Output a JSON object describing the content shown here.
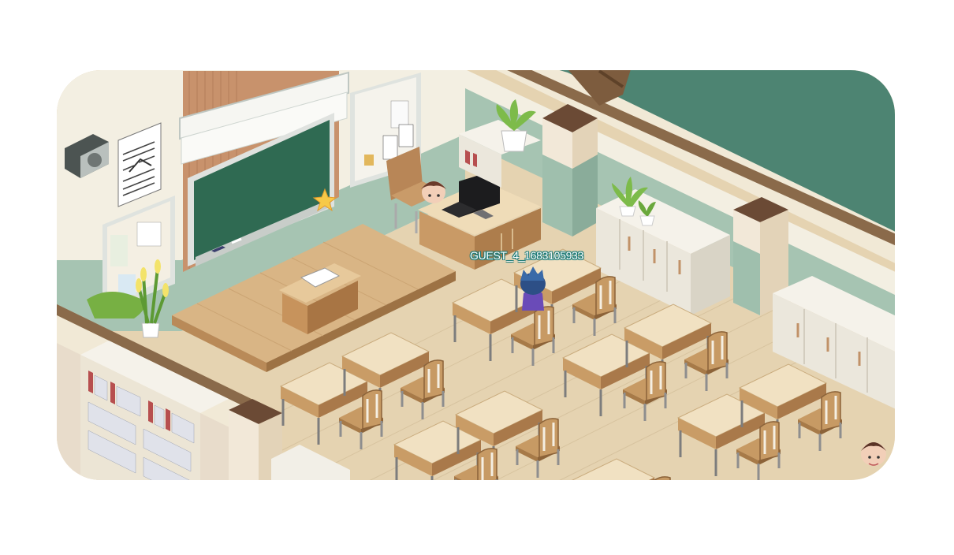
{
  "game": {
    "scene_name": "",
    "player": {
      "name_tag": "GUEST_4_1683105933",
      "name_tag_color": "#ffffff",
      "name_tag_outline": "#1d7b78"
    }
  },
  "palette": {
    "floor": "#e7d6b6",
    "wall_green": "#9fbfad",
    "wall_cream": "#f3efe2",
    "chalkboard": "#2f6a52",
    "wood": "#caa274",
    "desk_top": "#f0dfbf"
  },
  "icons": [
    "speaker-icon",
    "star-icon",
    "laptop-icon",
    "potted-plant-icon",
    "bookshelf-icon"
  ]
}
